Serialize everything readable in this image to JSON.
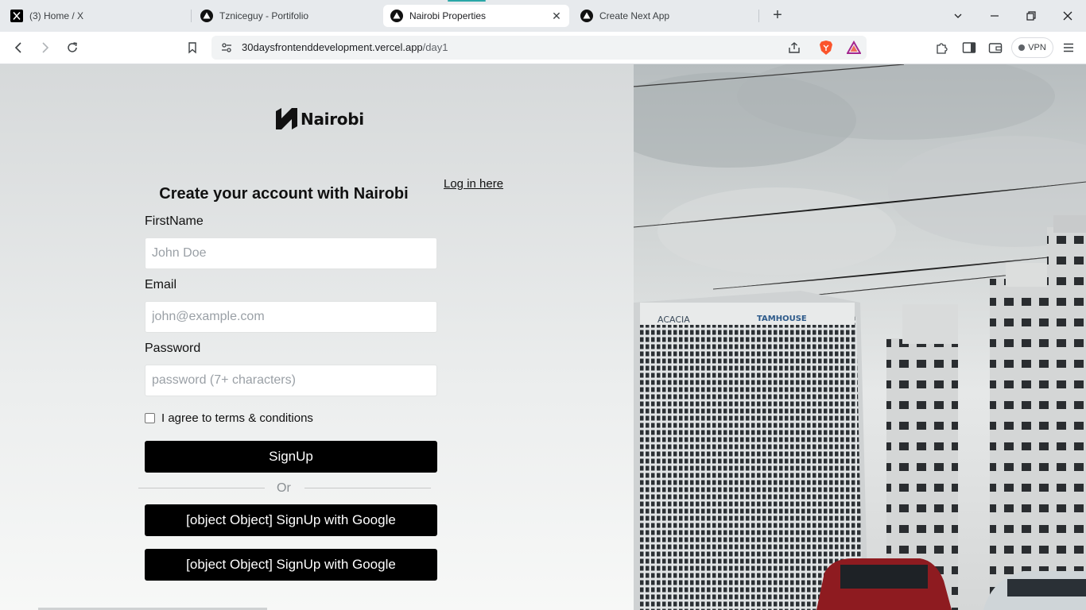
{
  "browser": {
    "tabs": [
      {
        "title": "(3) Home / X",
        "icon": "x-logo-icon"
      },
      {
        "title": "Tzniceguy - Portifolio",
        "icon": "vercel-triangle-icon"
      },
      {
        "title": "Nairobi Properties",
        "icon": "vercel-triangle-icon",
        "active": true
      },
      {
        "title": "Create Next App",
        "icon": "vercel-triangle-icon"
      }
    ],
    "url": {
      "host": "30daysfrontenddevelopment.vercel.app",
      "path": "/day1"
    },
    "vpn_label": "VPN"
  },
  "page": {
    "brand": "Nairobi",
    "heading": "Create your account with Nairobi",
    "login_link": "Log in here",
    "fields": {
      "firstname": {
        "label": "FirstName",
        "placeholder": "John Doe"
      },
      "email": {
        "label": "Email",
        "placeholder": "john@example.com"
      },
      "password": {
        "label": "Password",
        "placeholder": "password (7+ characters)"
      }
    },
    "terms_label": "I agree to terms & conditions",
    "terms_checked": false,
    "signup_button": "SignUp",
    "divider_text": "Or",
    "social_buttons": [
      "[object Object] SignUp with Google",
      "[object Object] SignUp with Google"
    ]
  },
  "photo": {
    "signs": [
      "ACACIA",
      "TAMHOUSE"
    ]
  }
}
